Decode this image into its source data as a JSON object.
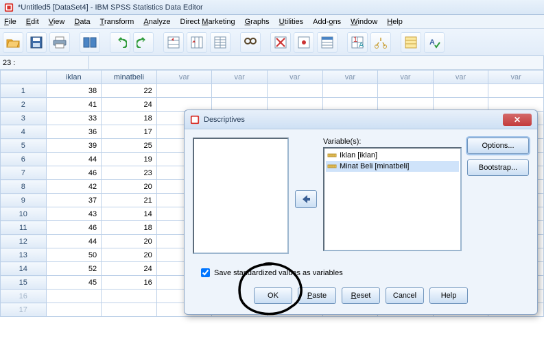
{
  "window": {
    "title": "*Untitled5 [DataSet4] - IBM SPSS Statistics Data Editor"
  },
  "menu": {
    "file": "File",
    "edit": "Edit",
    "view": "View",
    "data": "Data",
    "transform": "Transform",
    "analyze": "Analyze",
    "marketing": "Direct Marketing",
    "graphs": "Graphs",
    "utilities": "Utilities",
    "addons": "Add-ons",
    "window": "Window",
    "help": "Help"
  },
  "namebox": {
    "addr": "23 :",
    "value": ""
  },
  "columns": {
    "c0": "iklan",
    "c1": "minatbeli",
    "empty": "var"
  },
  "rows": [
    {
      "n": "1",
      "a": "38",
      "b": "22"
    },
    {
      "n": "2",
      "a": "41",
      "b": "24"
    },
    {
      "n": "3",
      "a": "33",
      "b": "18"
    },
    {
      "n": "4",
      "a": "36",
      "b": "17"
    },
    {
      "n": "5",
      "a": "39",
      "b": "25"
    },
    {
      "n": "6",
      "a": "44",
      "b": "19"
    },
    {
      "n": "7",
      "a": "46",
      "b": "23"
    },
    {
      "n": "8",
      "a": "42",
      "b": "20"
    },
    {
      "n": "9",
      "a": "37",
      "b": "21"
    },
    {
      "n": "10",
      "a": "43",
      "b": "14"
    },
    {
      "n": "11",
      "a": "46",
      "b": "18"
    },
    {
      "n": "12",
      "a": "44",
      "b": "20"
    },
    {
      "n": "13",
      "a": "50",
      "b": "20"
    },
    {
      "n": "14",
      "a": "52",
      "b": "24"
    },
    {
      "n": "15",
      "a": "45",
      "b": "16"
    },
    {
      "n": "16",
      "a": "",
      "b": ""
    },
    {
      "n": "17",
      "a": "",
      "b": ""
    }
  ],
  "dialog": {
    "title": "Descriptives",
    "vars_label": "Variable(s):",
    "vars": {
      "v0": "Iklan [iklan]",
      "v1": "Minat Beli [minatbeli]"
    },
    "options": "Options...",
    "bootstrap": "Bootstrap...",
    "savez": "Save standardized values as variables",
    "ok": "OK",
    "paste": "Paste",
    "reset": "Reset",
    "cancel": "Cancel",
    "help": "Help"
  }
}
